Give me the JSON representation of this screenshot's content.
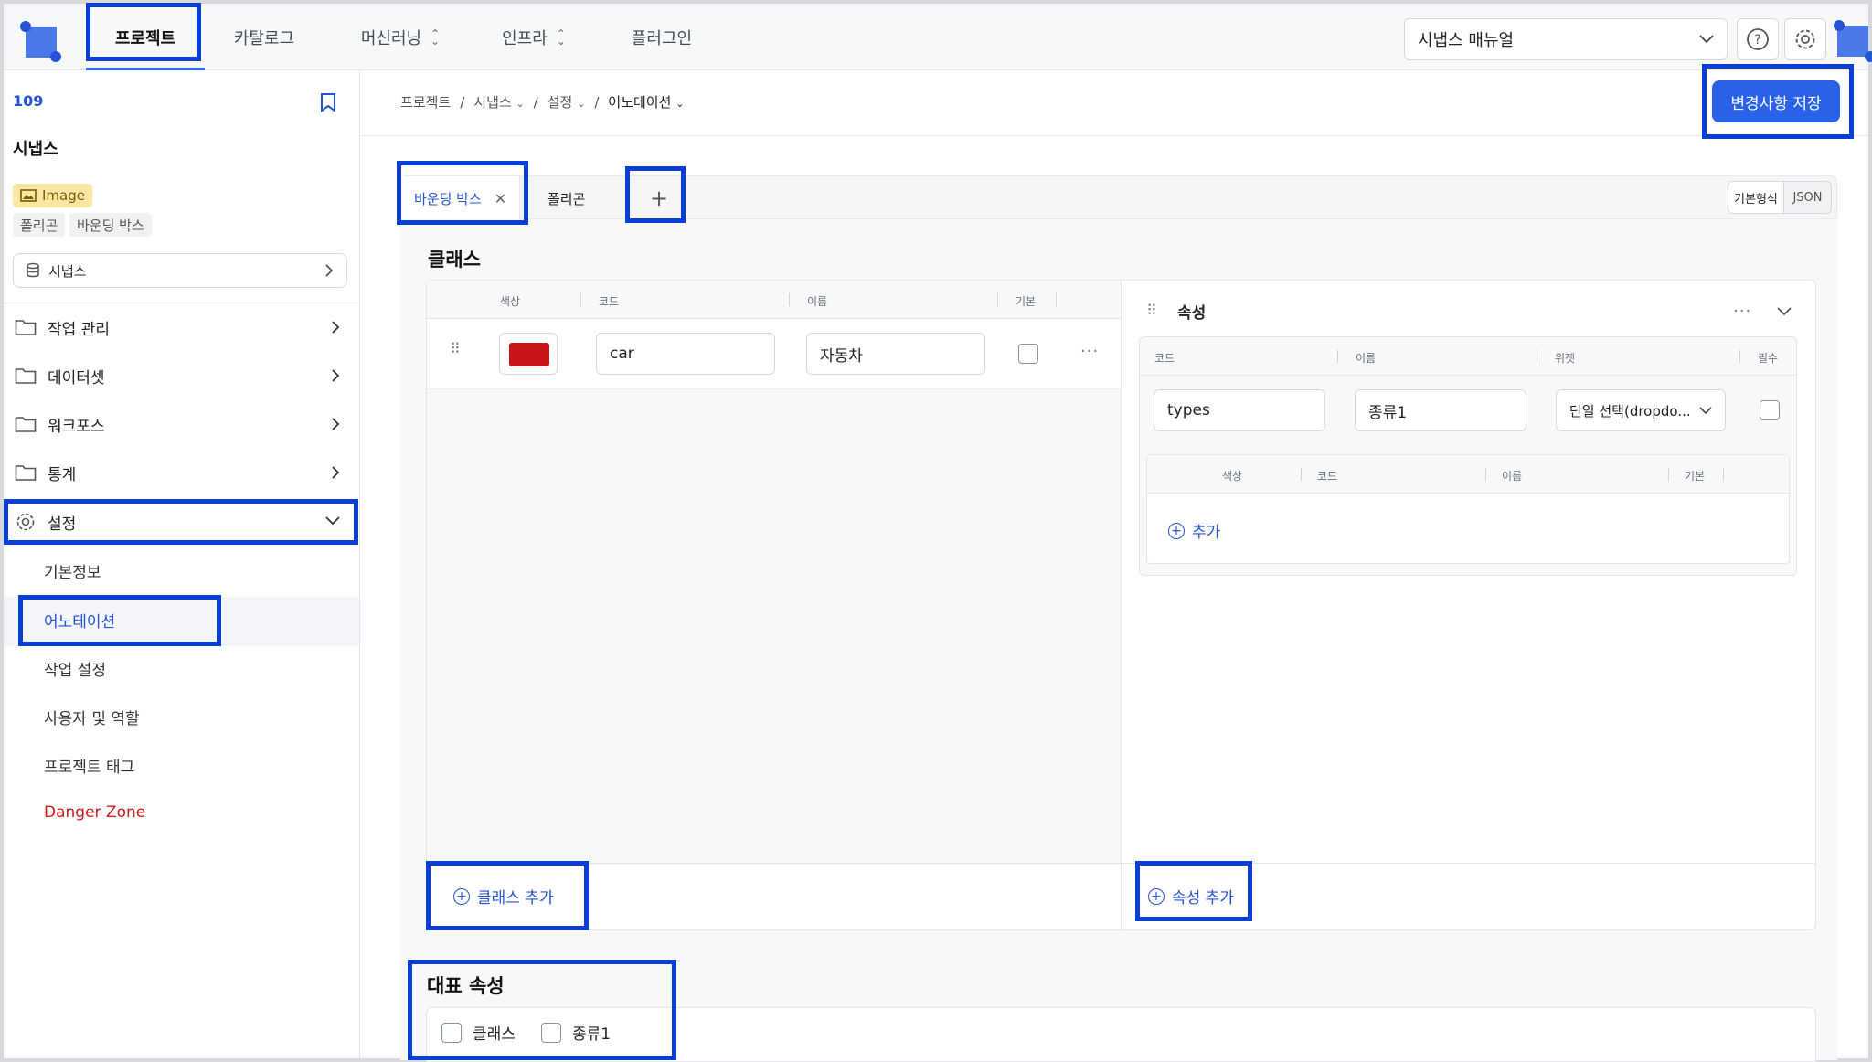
{
  "topnav": {
    "items": [
      {
        "label": "프로젝트",
        "active": true
      },
      {
        "label": "카탈로그"
      },
      {
        "label": "머신러닝",
        "dropdown": true
      },
      {
        "label": "인프라",
        "dropdown": true
      },
      {
        "label": "플러그인"
      }
    ],
    "manual_select": "시냅스 매뉴얼",
    "help_icon": "help-circle-icon",
    "settings_icon": "gear-icon"
  },
  "sidebar": {
    "project_id": "109",
    "project_name": "시냅스",
    "media_badge": "Image",
    "tags": [
      "폴리곤",
      "바운딩 박스"
    ],
    "dataset": "시냅스",
    "menus": [
      {
        "label": "작업 관리",
        "icon": "folder-icon"
      },
      {
        "label": "데이터셋",
        "icon": "folder-icon"
      },
      {
        "label": "워크포스",
        "icon": "folder-icon"
      },
      {
        "label": "통계",
        "icon": "folder-icon"
      },
      {
        "label": "설정",
        "icon": "gear-icon",
        "expanded": true
      }
    ],
    "submenus": [
      "기본정보",
      "어노테이션",
      "작업 설정",
      "사용자 및 역할",
      "프로젝트 태그",
      "Danger Zone"
    ],
    "active_submenu": "어노테이션",
    "danger_color": "#d11a1a"
  },
  "breadcrumb": [
    "프로젝트",
    "시냅스",
    "설정",
    "어노테이션"
  ],
  "save_button": "변경사항 저장",
  "tabs": {
    "items": [
      "바운딩 박스",
      "폴리곤"
    ],
    "active": "바운딩 박스",
    "add": "+"
  },
  "view_toggle": [
    "기본형식",
    "JSON"
  ],
  "classes": {
    "title": "클래스",
    "columns": [
      "색상",
      "코드",
      "이름",
      "기본"
    ],
    "rows": [
      {
        "color": "#c8151b",
        "code": "car",
        "name": "자동차",
        "default": false
      }
    ],
    "add_label": "클래스 추가"
  },
  "attributes": {
    "title": "속성",
    "columns": [
      "코드",
      "이름",
      "위젯",
      "필수"
    ],
    "row": {
      "code": "types",
      "name": "종류1",
      "widget": "단일 선택(dropdo...",
      "required": false
    },
    "option_columns": [
      "색상",
      "코드",
      "이름",
      "기본"
    ],
    "option_add": "추가",
    "add_label": "속성 추가"
  },
  "representative": {
    "title": "대표 속성",
    "items": [
      "클래스",
      "종류1"
    ]
  },
  "colors": {
    "accent": "#2962e9",
    "highlight": "#0a3fd6"
  }
}
